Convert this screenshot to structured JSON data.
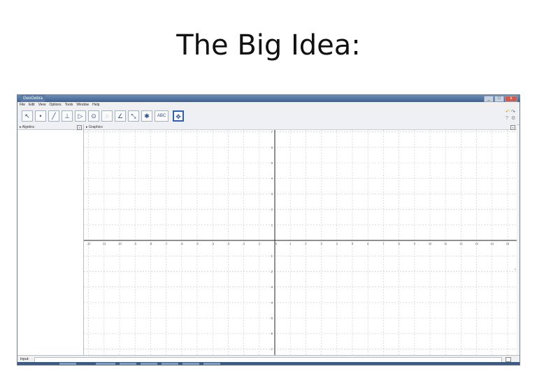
{
  "slide": {
    "title": "The Big Idea:"
  },
  "window": {
    "title": "GeoGebra",
    "controls": [
      "_",
      "□",
      "x"
    ]
  },
  "menu": [
    "File",
    "Edit",
    "View",
    "Options",
    "Tools",
    "Window",
    "Help"
  ],
  "toolbar": {
    "tools": [
      {
        "name": "move-tool",
        "glyph": "↖"
      },
      {
        "name": "point-tool",
        "glyph": "•"
      },
      {
        "name": "line-tool",
        "glyph": "╱"
      },
      {
        "name": "perpendicular-tool",
        "glyph": "⊥"
      },
      {
        "name": "polygon-tool",
        "glyph": "▷"
      },
      {
        "name": "circle-tool",
        "glyph": "⊙"
      },
      {
        "name": "circle-points-tool",
        "glyph": "◌"
      },
      {
        "name": "angle-tool",
        "glyph": "∠"
      },
      {
        "name": "reflect-tool",
        "glyph": "⤡"
      },
      {
        "name": "slider-tool",
        "glyph": "✱"
      },
      {
        "name": "text-tool",
        "glyph": "ABC"
      },
      {
        "name": "move-graphics-tool",
        "glyph": "✥"
      }
    ]
  },
  "panes": {
    "algebra": {
      "label": "Algebra"
    },
    "graphics": {
      "label": "Graphics"
    }
  },
  "graph": {
    "x_ticks": [
      "-12",
      "-11",
      "-10",
      "-9",
      "-8",
      "-7",
      "-6",
      "-5",
      "-4",
      "-3",
      "-2",
      "-1",
      "0",
      "1",
      "2",
      "3",
      "4",
      "5",
      "6",
      "7",
      "8",
      "9",
      "10",
      "11",
      "12",
      "13",
      "14",
      "15"
    ],
    "y_ticks": [
      "7",
      "6",
      "5",
      "4",
      "3",
      "2",
      "1",
      "-1",
      "-2",
      "-3",
      "-4",
      "-5",
      "-6",
      "-7"
    ]
  },
  "input": {
    "label": "Input:",
    "value": ""
  }
}
